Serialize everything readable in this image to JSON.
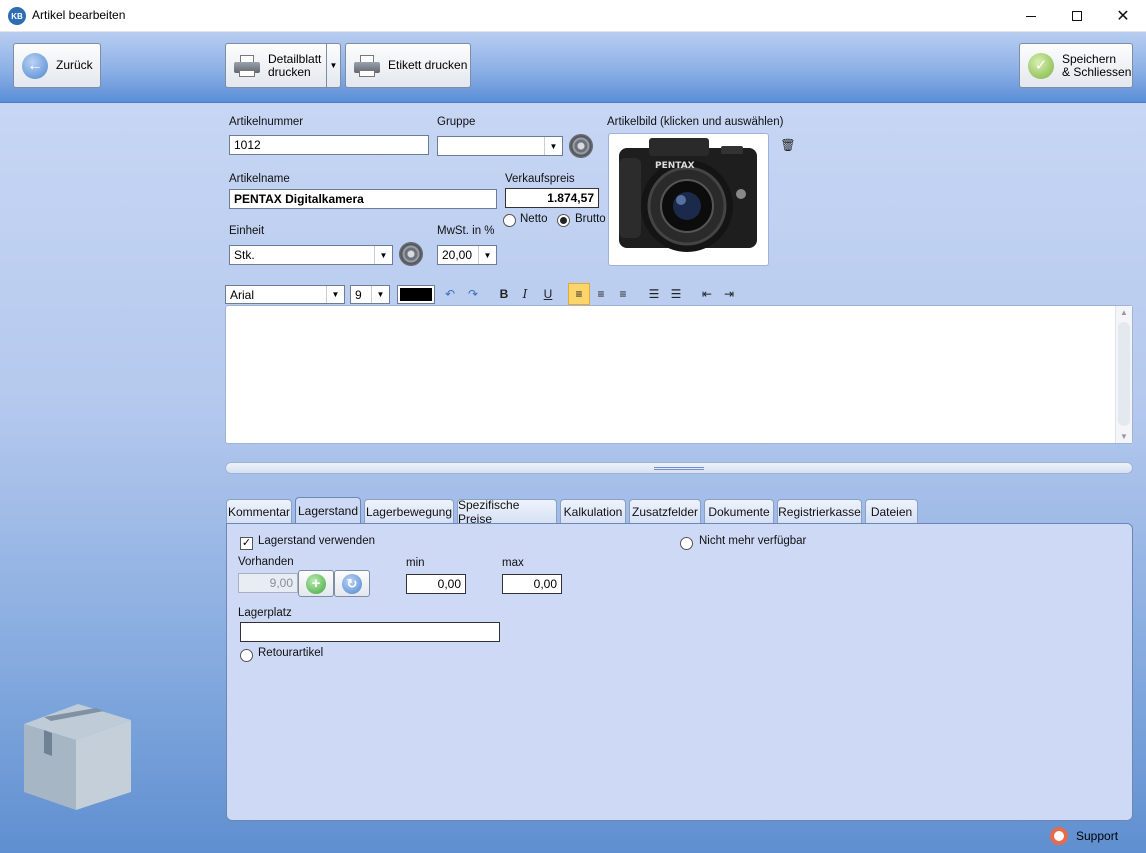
{
  "window": {
    "title": "Artikel bearbeiten",
    "logo": "KB"
  },
  "toolbar": {
    "back_label": "Zurück",
    "detail_print_label_line1": "Detailblatt",
    "detail_print_label_line2": "drucken",
    "label_print_label": "Etikett drucken",
    "save_label_line1": "Speichern",
    "save_label_line2": "& Schliessen"
  },
  "form": {
    "artikelnummer_label": "Artikelnummer",
    "artikelnummer_value": "1012",
    "gruppe_label": "Gruppe",
    "gruppe_value": "",
    "artikelbild_label": "Artikelbild (klicken und auswählen)",
    "artikelname_label": "Artikelname",
    "artikelname_value": "PENTAX Digitalkamera",
    "verkaufspreis_label": "Verkaufspreis",
    "verkaufspreis_value": "1.874,57",
    "netto_label": "Netto",
    "brutto_label": "Brutto",
    "price_mode": "Brutto",
    "einheit_label": "Einheit",
    "einheit_value": "Stk.",
    "mwst_label": "MwSt. in %",
    "mwst_value": "20,00"
  },
  "image": {
    "camera_brand_text": "PENTAX"
  },
  "editor": {
    "font_value": "Arial",
    "size_value": "9",
    "text_color": "#000000",
    "content": ""
  },
  "tabs": [
    {
      "label": "Kommentar"
    },
    {
      "label": "Lagerstand"
    },
    {
      "label": "Lagerbewegung"
    },
    {
      "label": "Spezifische Preise"
    },
    {
      "label": "Kalkulation"
    },
    {
      "label": "Zusatzfelder"
    },
    {
      "label": "Dokumente"
    },
    {
      "label": "Registrierkasse"
    },
    {
      "label": "Dateien"
    }
  ],
  "active_tab": "Lagerstand",
  "stock": {
    "use_stock_label": "Lagerstand verwenden",
    "use_stock_checked": true,
    "unavailable_label": "Nicht mehr verfügbar",
    "vorhanden_label": "Vorhanden",
    "vorhanden_value": "9,00",
    "min_label": "min",
    "min_value": "0,00",
    "max_label": "max",
    "max_value": "0,00",
    "lagerplatz_label": "Lagerplatz",
    "lagerplatz_value": "",
    "retour_label": "Retourartikel"
  },
  "footer": {
    "support_label": "Support"
  },
  "colors": {
    "accent": "#5b8ed6",
    "panel": "#cdd9f5"
  }
}
